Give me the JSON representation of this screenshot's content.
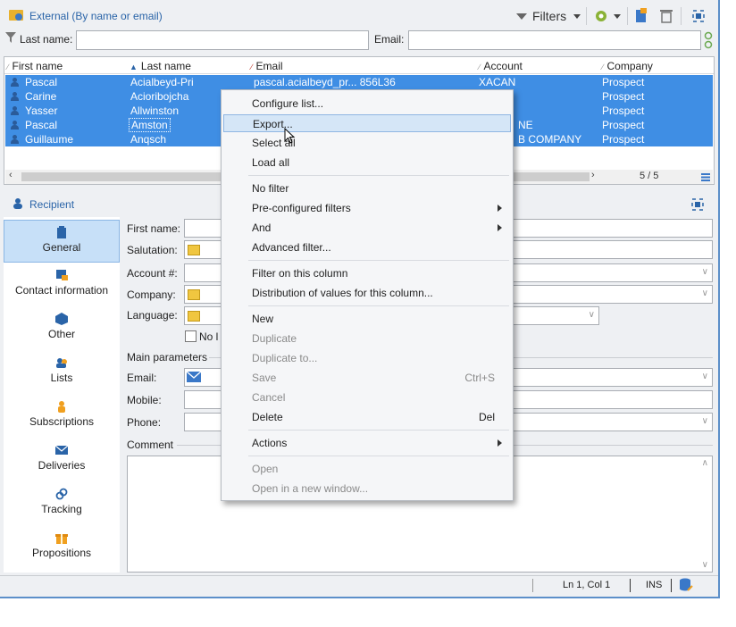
{
  "toolbar": {
    "title": "External (By name or email)",
    "filters_label": "Filters"
  },
  "filter_row": {
    "lastname_label": "Last name:",
    "lastname_value": "",
    "email_label": "Email:",
    "email_value": ""
  },
  "grid": {
    "columns": [
      "First name",
      "Last name",
      "Email",
      "Account",
      "Company"
    ],
    "rows": [
      {
        "first": "Pascal",
        "last": "Acialbeyd-Pri",
        "email": "pascal.acialbeyd_pr... 856L36",
        "account": "XACAN",
        "company": "Prospect"
      },
      {
        "first": "Carine",
        "last": "Acioribojcha",
        "email": "",
        "account": "",
        "company": "Prospect"
      },
      {
        "first": "Yasser",
        "last": "Allwinston",
        "email": "",
        "account": "",
        "company": "Prospect"
      },
      {
        "first": "Pascal",
        "last": "Amston",
        "email": "",
        "account": "NE",
        "company": "Prospect"
      },
      {
        "first": "Guillaume",
        "last": "Anqsch",
        "email": "",
        "account": "B COMPANY",
        "company": "Prospect"
      }
    ],
    "page_count": "5 / 5"
  },
  "detail": {
    "title": "Recipient",
    "nav": [
      "General",
      "Contact information",
      "Other",
      "Lists",
      "Subscriptions",
      "Deliveries",
      "Tracking",
      "Propositions"
    ],
    "fields": {
      "first_name": "First name:",
      "salutation": "Salutation:",
      "account": "Account #:",
      "company": "Company:",
      "language": "Language:",
      "no_label": "No l",
      "main_params": "Main parameters",
      "email": "Email:",
      "mobile": "Mobile:",
      "phone": "Phone:",
      "comment": "Comment"
    }
  },
  "status": {
    "position": "Ln 1, Col 1",
    "mode": "INS"
  },
  "context_menu": {
    "items": [
      {
        "label": "Configure list...",
        "state": "normal"
      },
      {
        "label": "Export...",
        "state": "highlighted"
      },
      {
        "label": "Select all",
        "state": "normal"
      },
      {
        "label": "Load all",
        "state": "normal"
      },
      {
        "label": "No filter",
        "state": "normal"
      },
      {
        "label": "Pre-configured filters",
        "state": "submenu"
      },
      {
        "label": "And",
        "state": "submenu"
      },
      {
        "label": "Advanced filter...",
        "state": "normal"
      },
      {
        "label": "Filter on this column",
        "state": "normal"
      },
      {
        "label": "Distribution of values for this column...",
        "state": "normal"
      },
      {
        "label": "New",
        "state": "normal"
      },
      {
        "label": "Duplicate",
        "state": "disabled"
      },
      {
        "label": "Duplicate to...",
        "state": "disabled"
      },
      {
        "label": "Save",
        "state": "disabled",
        "shortcut": "Ctrl+S"
      },
      {
        "label": "Cancel",
        "state": "disabled"
      },
      {
        "label": "Delete",
        "state": "normal",
        "shortcut": "Del"
      },
      {
        "label": "Actions",
        "state": "submenu"
      },
      {
        "label": "Open",
        "state": "disabled"
      },
      {
        "label": "Open in a new window...",
        "state": "disabled"
      }
    ]
  },
  "colors": {
    "selection": "#3f8ee4",
    "accent": "#2a64a8",
    "menu_highlight": "#d5e6f7"
  }
}
